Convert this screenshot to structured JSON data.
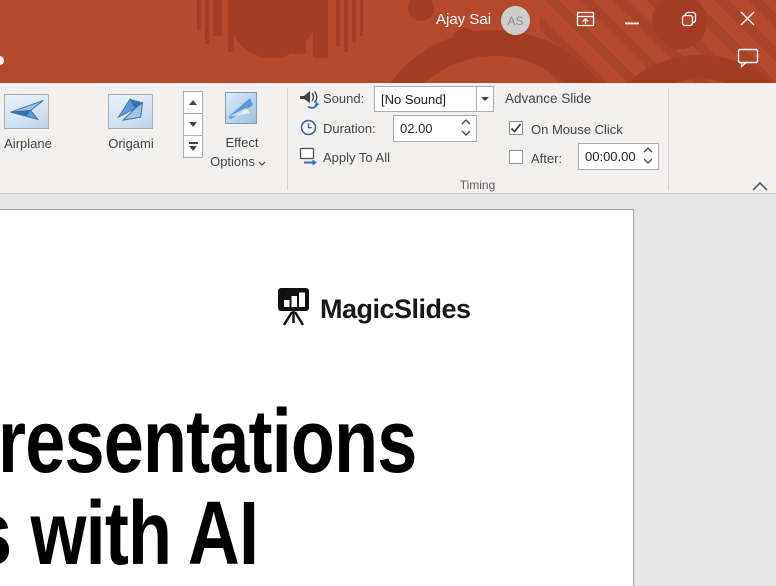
{
  "titlebar": {
    "user_name": "Ajay Sai",
    "avatar_initials": "AS"
  },
  "ribbon": {
    "gallery": {
      "items": [
        {
          "label": "Airplane"
        },
        {
          "label": "Origami"
        }
      ]
    },
    "effect_options": {
      "line1": "Effect",
      "line2": "Options"
    },
    "timing": {
      "sound_label": "Sound:",
      "sound_value": "[No Sound]",
      "duration_label": "Duration:",
      "duration_value": "02.00",
      "apply_to_all": "Apply To All",
      "advance_slide": "Advance Slide",
      "on_mouse_click": "On Mouse Click",
      "after_label": "After:",
      "after_value": "00:00.00",
      "group_label": "Timing"
    }
  },
  "slide": {
    "logo_text": "MagicSlides",
    "title_line1": "resentations",
    "title_line2": "s with AI"
  },
  "states": {
    "on_mouse_click_checked": true,
    "after_checked": false
  },
  "colors": {
    "titlebar_red": "#B4492C",
    "pattern_red": "#A23D23",
    "ribbon_bg": "#F1F0EF",
    "workspace_bg": "#E7E6E6",
    "accent_blue": "#2E75B6"
  }
}
